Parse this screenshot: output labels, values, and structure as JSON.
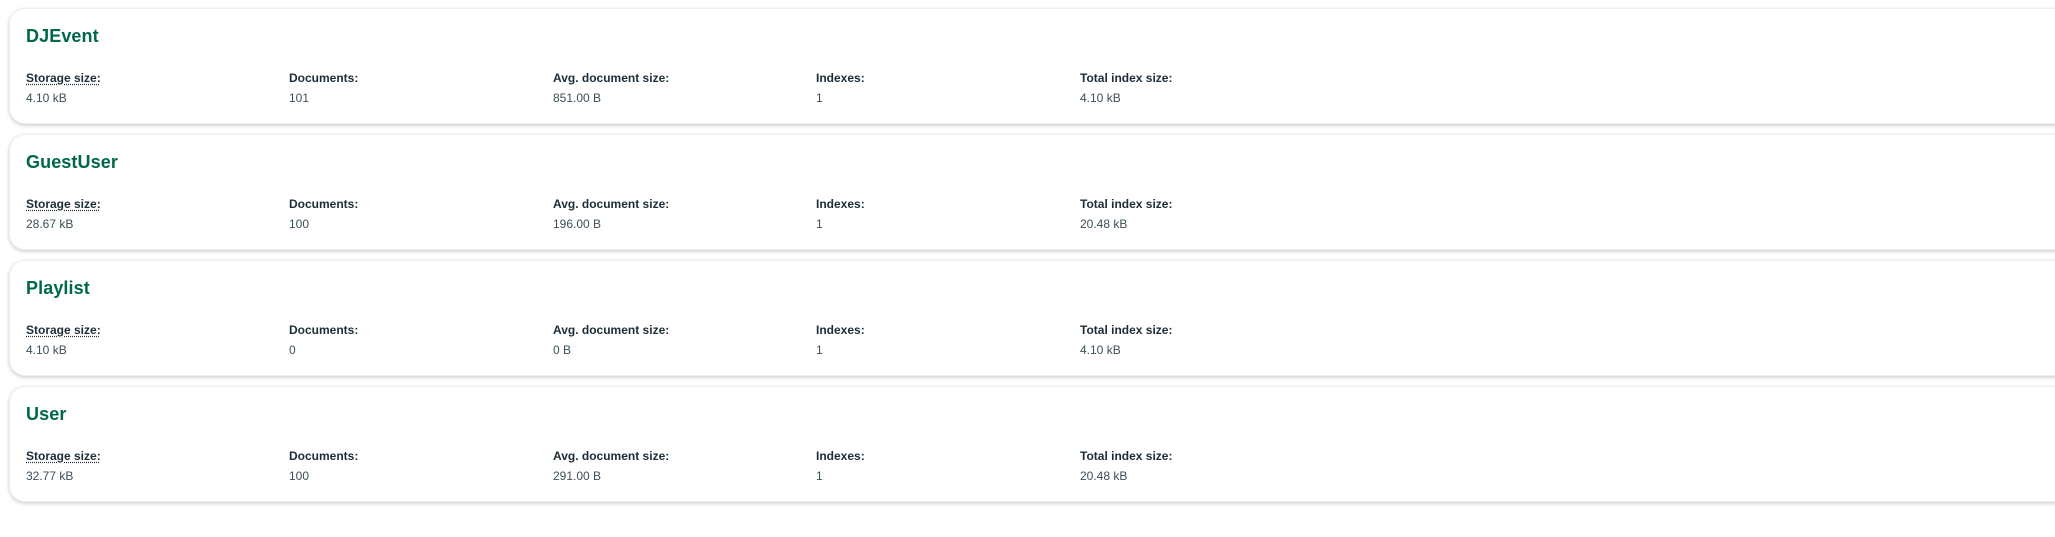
{
  "labels": {
    "storage_size": "Storage size:",
    "documents": "Documents:",
    "avg_document_size": "Avg. document size:",
    "indexes": "Indexes:",
    "total_index_size": "Total index size:"
  },
  "collections": [
    {
      "name": "DJEvent",
      "storage_size": "4.10 kB",
      "documents": "101",
      "avg_document_size": "851.00 B",
      "indexes": "1",
      "total_index_size": "4.10 kB"
    },
    {
      "name": "GuestUser",
      "storage_size": "28.67 kB",
      "documents": "100",
      "avg_document_size": "196.00 B",
      "indexes": "1",
      "total_index_size": "20.48 kB"
    },
    {
      "name": "Playlist",
      "storage_size": "4.10 kB",
      "documents": "0",
      "avg_document_size": "0 B",
      "indexes": "1",
      "total_index_size": "4.10 kB"
    },
    {
      "name": "User",
      "storage_size": "32.77 kB",
      "documents": "100",
      "avg_document_size": "291.00 B",
      "indexes": "1",
      "total_index_size": "20.48 kB"
    }
  ]
}
